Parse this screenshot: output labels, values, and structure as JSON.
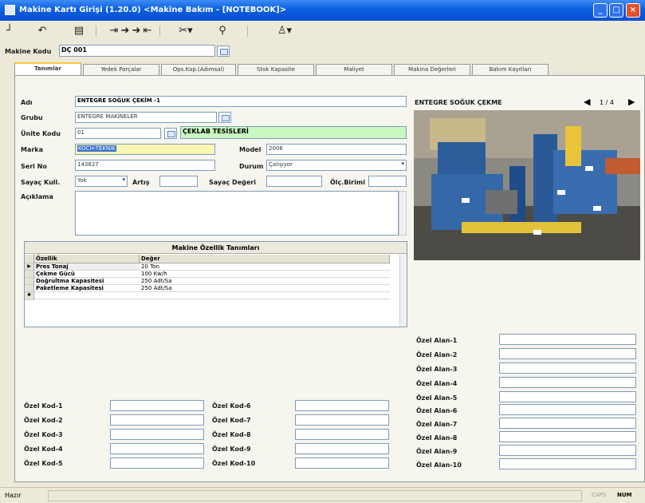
{
  "window": {
    "title": "Makine Kartı Girişi (1.20.0) <Makine Bakım - [NOTEBOOK]>"
  },
  "toolbar": {
    "items": [
      "exit-icon",
      "undo-icon",
      "print-icon",
      "first-icon",
      "prev-icon",
      "next-icon",
      "last-icon",
      "delete-icon",
      "filter-icon",
      "user-icon"
    ]
  },
  "header": {
    "label": "Makine Kodu",
    "value": "DÇ 001"
  },
  "tabs": [
    "Tanımlar",
    "Yedek Parçalar",
    "Ops.Kap.(Adımsal)",
    "Stok Kapasite",
    "Maliyet",
    "Makina Değerleri",
    "Bakım Kayıtları"
  ],
  "form": {
    "ad": {
      "label": "Adı",
      "value": "ENTEGRE SOĞUK ÇEKİM -1"
    },
    "grubu": {
      "label": "Grubu",
      "value": "ENTEGRE MAKİNELER"
    },
    "unite": {
      "label": "Ünite Kodu",
      "value": "01",
      "desc": "ÇEKLAB TESİSLERİ"
    },
    "marka": {
      "label": "Marka",
      "value": "KOCH-TEKNIK"
    },
    "model": {
      "label": "Model",
      "value": "2006"
    },
    "seri": {
      "label": "Seri No",
      "value": "143827"
    },
    "durum": {
      "label": "Durum",
      "value": "Çalışıyor"
    },
    "sayac": {
      "label": "Sayaç Kull.",
      "value": "Yok",
      "artis_label": "Artış",
      "deger_label": "Sayaç Değeri",
      "birim_label": "Ölç.Birimi"
    },
    "aciklama": {
      "label": "Açıklama"
    }
  },
  "photo": {
    "caption": "ENTEGRE SOĞUK ÇEKME",
    "page": "1 / 4"
  },
  "features": {
    "title": "Makine Özellik Tanımları",
    "columns": [
      "Özellik",
      "Değer"
    ],
    "rows": [
      [
        "Pres Tonaj",
        "20 Ton"
      ],
      [
        "Çekme Gücü",
        "100 Kw/h"
      ],
      [
        "Doğrultma Kapasitesi",
        "250 Adt/Sa"
      ],
      [
        "Paketleme Kapasitesi",
        "250 Adt/Sa"
      ]
    ]
  },
  "ozelKod": [
    "Özel Kod-1",
    "Özel Kod-2",
    "Özel Kod-3",
    "Özel Kod-4",
    "Özel Kod-5",
    "Özel Kod-6",
    "Özel Kod-7",
    "Özel Kod-8",
    "Özel Kod-9",
    "Özel Kod-10"
  ],
  "ozelAlan": [
    "Özel Alan-1",
    "Özel Alan-2",
    "Özel Alan-3",
    "Özel Alan-4",
    "Özel Alan-5",
    "Özel Alan-6",
    "Özel Alan-7",
    "Özel Alan-8",
    "Özel Alan-9",
    "Özel Alan-10"
  ],
  "status": {
    "left": "Hazır",
    "caps": "CAPS",
    "num": "NUM"
  },
  "colors": {
    "title": "#0b4ecf",
    "marka_bg": "#fdf7b3",
    "unite_desc_bg": "#c8f7c0"
  }
}
